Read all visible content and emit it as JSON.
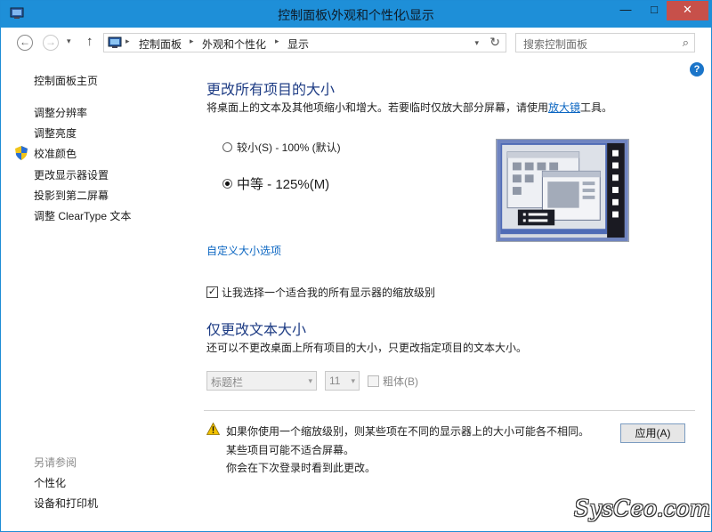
{
  "window": {
    "title": "控制面板\\外观和个性化\\显示",
    "minimize": "—",
    "maximize": "□",
    "close": "✕"
  },
  "nav": {
    "back": "←",
    "forward": "→",
    "dropdown": "▾",
    "up": "↑",
    "breadcrumbs": [
      "控制面板",
      "外观和个性化",
      "显示"
    ],
    "separator": "▸",
    "refresh": "↻",
    "search_placeholder": "搜索控制面板",
    "search_icon": "⌕",
    "help": "?"
  },
  "sidebar": {
    "items": [
      "控制面板主页",
      "调整分辨率",
      "调整亮度",
      "校准颜色",
      "更改显示器设置",
      "投影到第二屏幕",
      "调整 ClearType 文本"
    ],
    "see_also_label": "另请参阅",
    "see_also": [
      "个性化",
      "设备和打印机"
    ]
  },
  "main": {
    "title": "更改所有项目的大小",
    "desc_prefix": "将桌面上的文本及其他项缩小和增大。若要临时仅放大部分屏幕，请使用",
    "desc_link": "放大镜",
    "desc_suffix": "工具。",
    "option_small": "较小(S) - 100% (默认)",
    "option_medium": "中等 - 125%(M)",
    "custom_sizing_link": "自定义大小选项",
    "checkbox_label": "让我选择一个适合我的所有显示器的缩放级别",
    "checkbox_mark": "✓",
    "section2_title": "仅更改文本大小",
    "section2_desc": "还可以不更改桌面上所有项目的大小，只更改指定项目的文本大小。",
    "item_select_value": "标题栏",
    "size_select_value": "11",
    "bold_label": "粗体(B)",
    "select_arrow": "▾",
    "warning_lines": [
      "如果你使用一个缩放级别，则某些项在不同的显示器上的大小可能各不相同。",
      "某些项目可能不适合屏幕。",
      "你会在下次登录时看到此更改。"
    ],
    "apply_button": "应用(A)"
  },
  "watermark": "SysCeo.com",
  "colors": {
    "titlebar": "#1e8fd8",
    "heading": "#1e3c84",
    "link": "#0b66c2",
    "close_button": "#c7504a"
  }
}
